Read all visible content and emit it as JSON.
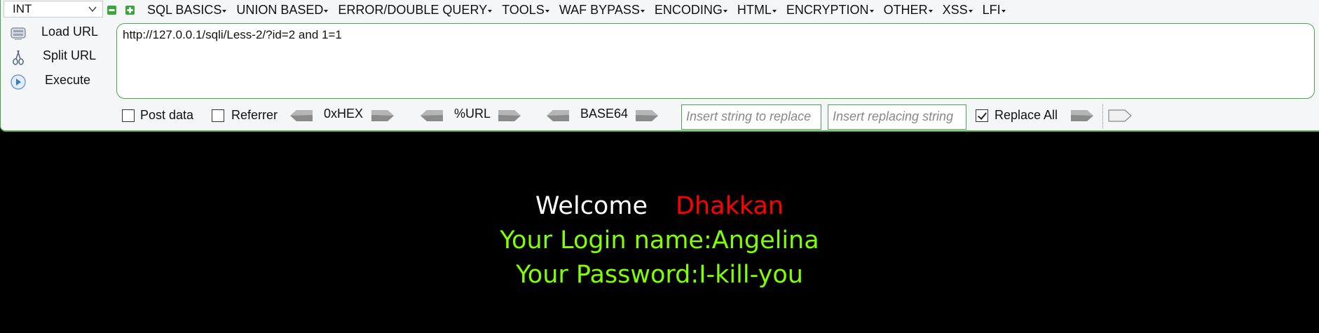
{
  "toolbar": {
    "select_value": "INT",
    "menu": [
      "SQL BASICS",
      "UNION BASED",
      "ERROR/DOUBLE QUERY",
      "TOOLS",
      "WAF BYPASS",
      "ENCODING",
      "HTML",
      "ENCRYPTION",
      "OTHER",
      "XSS",
      "LFI"
    ],
    "actions": {
      "load": "Load URL",
      "split": "Split URL",
      "execute": "Execute"
    },
    "url_value": "http://127.0.0.1/sqli/Less-2/?id=2 and 1=1",
    "options": {
      "post_data": "Post data",
      "referrer": "Referrer",
      "hex": "0xHEX",
      "url": "%URL",
      "base64": "BASE64",
      "replace_placeholder": "Insert string to replace",
      "replacing_placeholder": "Insert replacing string",
      "replace_all": "Replace All"
    },
    "accent_color": "#4aa64a"
  },
  "page": {
    "welcome": "Welcome",
    "name": "Dhakkan",
    "login_line": "Your Login name:Angelina",
    "password_line": "Your Password:I-kill-you",
    "colors": {
      "background": "#000000",
      "welcome": "#ffffff",
      "name": "#ff0000",
      "info": "#7fff00"
    }
  }
}
